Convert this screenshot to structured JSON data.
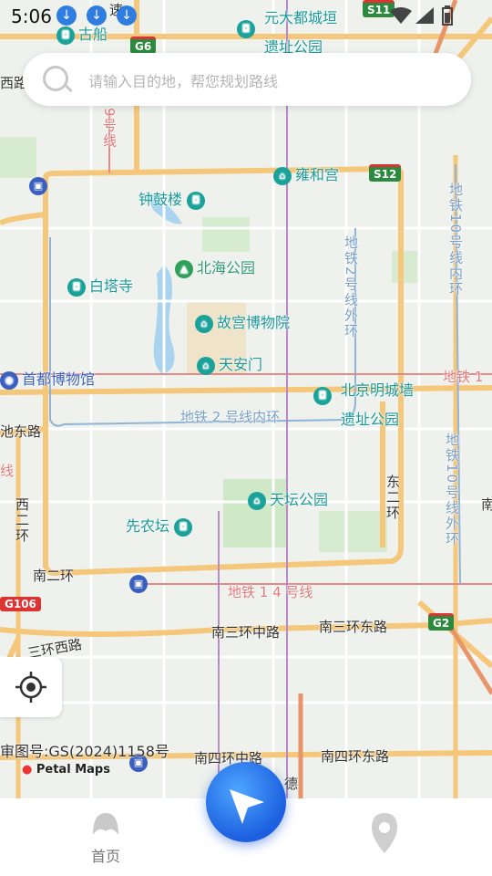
{
  "status_bar": {
    "time": "5:06"
  },
  "search": {
    "placeholder": "请输入目的地，帮您规划路线"
  },
  "map": {
    "pois": {
      "guchuan": "古船",
      "yuandadu": "元大都城垣",
      "yuandadu2": "遗址公园",
      "yonghegong": "雍和宫",
      "zhonggulou": "钟鼓楼",
      "beihai": "北海公园",
      "baita": "白塔寺",
      "gugong": "故宫博物院",
      "tiananmen": "天安门",
      "shoudu": "首都博物馆",
      "mingcheng": "北京明城墙",
      "mingcheng2": "遗址公园",
      "tiantan": "天坛公园",
      "xiannong": "先农坛"
    },
    "roads": {
      "xisi": "西路",
      "chidong": "池东路",
      "nanerhuan": "南二环",
      "xierhuan": "西二环",
      "dongerhuan": "东二环",
      "nansan_zhong": "南三环中路",
      "nansan_dong": "南三环东路",
      "nansan_xi": "三环西路",
      "nansi_zhong": "南四环中路",
      "nansi_dong": "南四环东路",
      "de": "德",
      "nan": "南",
      "su": "速"
    },
    "metro": {
      "line9": "9号线",
      "line2_in": "地铁 2 号线内环",
      "line2_out": "地铁2号线外环",
      "line10_in": "地铁10号线内环",
      "line10_out": "地铁10号线外环",
      "line1": "地铁 1",
      "line14": "地铁 1 4 号线",
      "line_partial": "内环",
      "xian": "线"
    },
    "shields": {
      "g6": "G6",
      "s11": "S11",
      "s12": "S12",
      "g106": "G106",
      "g2": "G2"
    }
  },
  "attribution": {
    "review_no": "审图号:GS(2024)1158号",
    "brand": "Petal Maps"
  },
  "nav": {
    "home_label": "首页"
  },
  "colors": {
    "accent": "#1c5fe0",
    "road_major": "#f5c77a",
    "park": "#cfe8c8",
    "water": "#a9d3ef"
  }
}
